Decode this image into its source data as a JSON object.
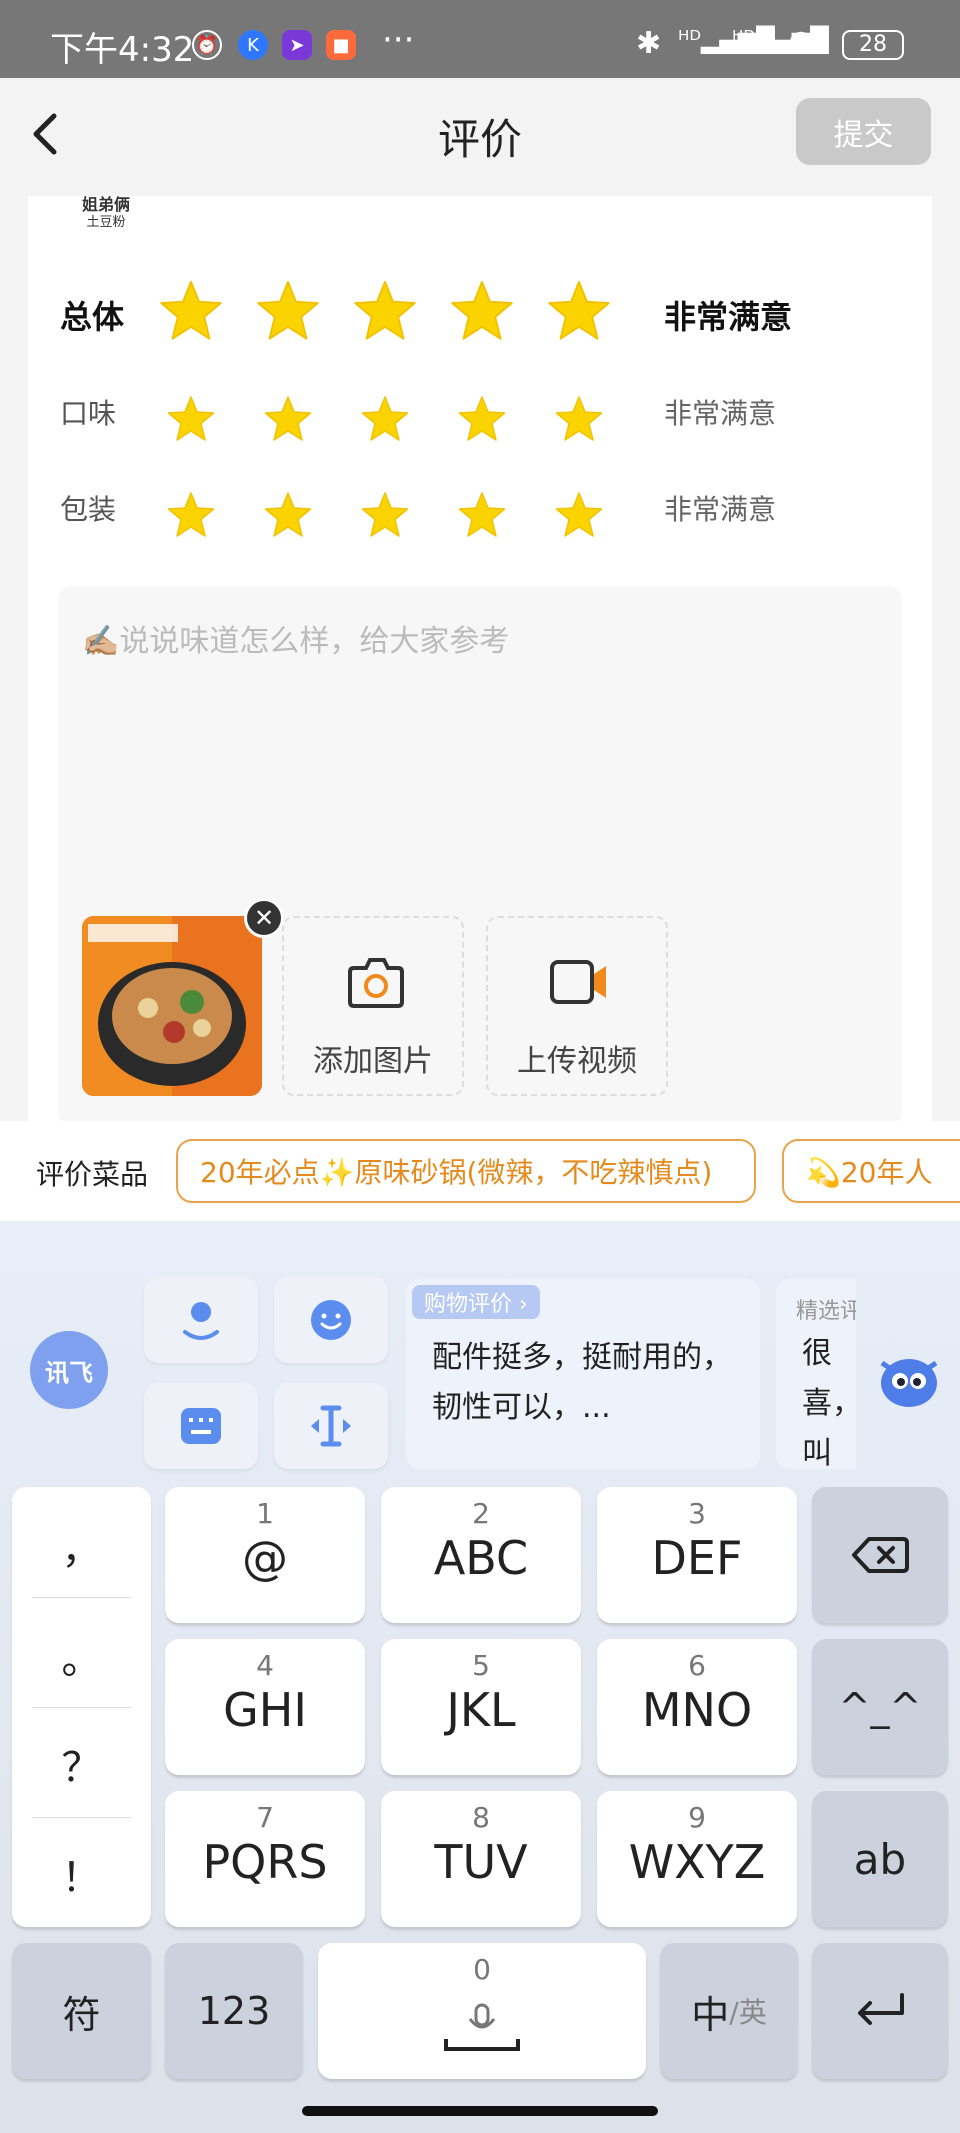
{
  "status_bar": {
    "time": "下午4:32",
    "battery": "28",
    "dots": "···"
  },
  "header": {
    "title": "评价",
    "back_icon": "chevron-left-icon",
    "submit_label": "提交"
  },
  "shop": {
    "logo_line1": "姐弟俩",
    "logo_line2": "土豆粉"
  },
  "ratings": [
    {
      "label": "总体",
      "stars": 5,
      "value": "非常满意"
    },
    {
      "label": "口味",
      "stars": 5,
      "value": "非常满意"
    },
    {
      "label": "包装",
      "stars": 5,
      "value": "非常满意"
    }
  ],
  "review": {
    "placeholder": "✍🏼说说味道怎么样，给大家参考",
    "add_image_label": "添加图片",
    "upload_video_label": "上传视频"
  },
  "dish_bar": {
    "label": "评价菜品",
    "chips": [
      "20年必点✨原味砂锅(微辣，不吃辣慎点)",
      "💫20年人"
    ]
  },
  "keyboard": {
    "logo": "讯飞",
    "ai_tag": "购物评价 ›",
    "ai_suggestion": "配件挺多，挺耐用的，韧性可以，...",
    "ai_tag2": "精选评",
    "ai_suggestion2": "很喜，叫",
    "punct": [
      "，",
      "。",
      "？",
      "！"
    ],
    "keys": [
      {
        "num": "1",
        "main": "@"
      },
      {
        "num": "2",
        "main": "ABC"
      },
      {
        "num": "3",
        "main": "DEF"
      },
      {
        "num": "4",
        "main": "GHI"
      },
      {
        "num": "5",
        "main": "JKL"
      },
      {
        "num": "6",
        "main": "MNO"
      },
      {
        "num": "7",
        "main": "PQRS"
      },
      {
        "num": "8",
        "main": "TUV"
      },
      {
        "num": "9",
        "main": "WXYZ"
      }
    ],
    "emoticon_key": "^_^",
    "ab_key": "ab",
    "symbol_key": "符",
    "num_key": "123",
    "space_num": "0",
    "lang_key_main": "中",
    "lang_key_sub": "/英"
  },
  "colors": {
    "star": "#fbd400",
    "chip": "#e58a1c",
    "submit_disabled": "#c9c9c9"
  }
}
